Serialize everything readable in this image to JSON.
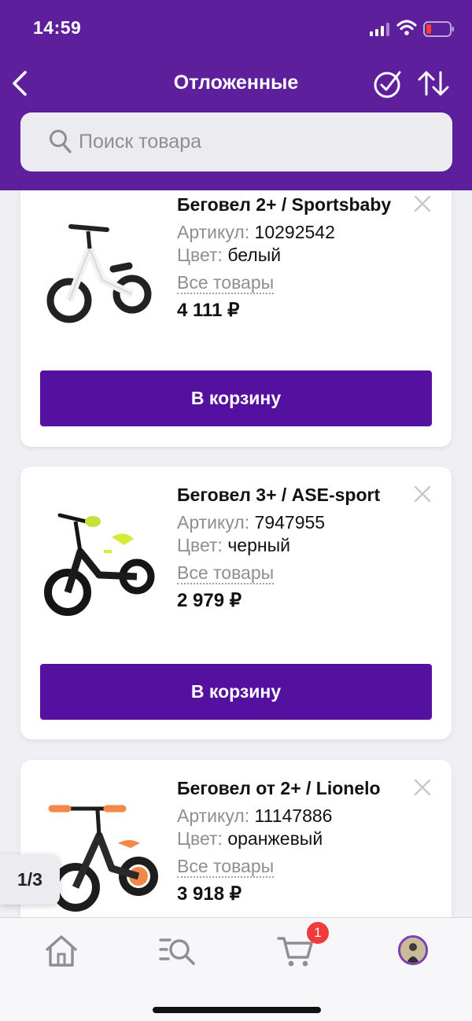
{
  "status": {
    "time": "14:59"
  },
  "header": {
    "title": "Отложенные"
  },
  "search": {
    "placeholder": "Поиск товара"
  },
  "labels": {
    "sku_label": "Артикул:",
    "color_label": "Цвет:",
    "all_goods": "Все товары",
    "add_to_cart": "В корзину"
  },
  "products": [
    {
      "name": "Беговел 2+ / Sportsbaby",
      "sku": "10292542",
      "color": "белый",
      "price": "4 111 ₽"
    },
    {
      "name": "Беговел 3+ / ASE-sport",
      "sku": "7947955",
      "color": "черный",
      "price": "2 979 ₽"
    },
    {
      "name": "Беговел от 2+ / Lionelo",
      "sku": "11147886",
      "color": "оранжевый",
      "price": "3 918 ₽"
    }
  ],
  "pager": {
    "text": "1/3"
  },
  "tabbar": {
    "cart_badge": "1"
  },
  "colors": {
    "brand": "#5e1f9c",
    "button": "#5411a0",
    "badge": "#ef3b3b"
  }
}
